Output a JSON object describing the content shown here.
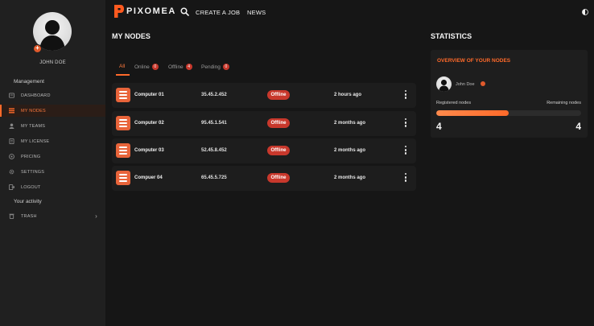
{
  "app": {
    "logo_text": "PIXOMEA"
  },
  "colors": {
    "accent": "#ff6a2a",
    "offline": "#c8382c",
    "bg": "#161616",
    "sidebar": "#202020"
  },
  "user": {
    "name": "JOHN DOE",
    "badge": "+"
  },
  "sidebar": {
    "section_management": "Management",
    "section_activity": "Your activity",
    "items": [
      {
        "label": "DASHBOARD",
        "icon": "dashboard-icon"
      },
      {
        "label": "MY NODES",
        "icon": "list-icon",
        "active": true
      },
      {
        "label": "MY TEAMS",
        "icon": "team-icon"
      },
      {
        "label": "MY LICENSE",
        "icon": "license-icon"
      },
      {
        "label": "PRICING",
        "icon": "pricing-icon"
      },
      {
        "label": "SETTINGS",
        "icon": "gear-icon"
      },
      {
        "label": "LOGOUT",
        "icon": "logout-icon"
      }
    ],
    "trash": {
      "label": "TRASH",
      "icon": "trash-icon",
      "chevron": "›"
    }
  },
  "topbar": {
    "create_job": "CREATE A JOB",
    "news": "NEWS"
  },
  "nodes": {
    "title": "MY NODES",
    "tabs": [
      {
        "label": "All",
        "count": ""
      },
      {
        "label": "Online",
        "count": "0"
      },
      {
        "label": "Offline",
        "count": "4"
      },
      {
        "label": "Pending",
        "count": "0"
      }
    ],
    "rows": [
      {
        "name": "Computer 01",
        "ip": "35.45.2.452",
        "status": "Offline",
        "time": "2 hours ago"
      },
      {
        "name": "Computer 02",
        "ip": "95.45.1.541",
        "status": "Offline",
        "time": "2 months ago"
      },
      {
        "name": "Computer 03",
        "ip": "52.45.8.452",
        "status": "Offline",
        "time": "2 months ago"
      },
      {
        "name": "Compuer 04",
        "ip": "65.45.5.725",
        "status": "Offline",
        "time": "2 months ago"
      }
    ]
  },
  "stats": {
    "title": "STATISTICS",
    "card_title": "OVERVIEW OF YOUR NODES",
    "user_name": "John Doe",
    "registered_label": "Registered nodes",
    "remaining_label": "Remaining nodes",
    "registered_value": "4",
    "remaining_value": "4",
    "progress_fraction": 0.5
  }
}
